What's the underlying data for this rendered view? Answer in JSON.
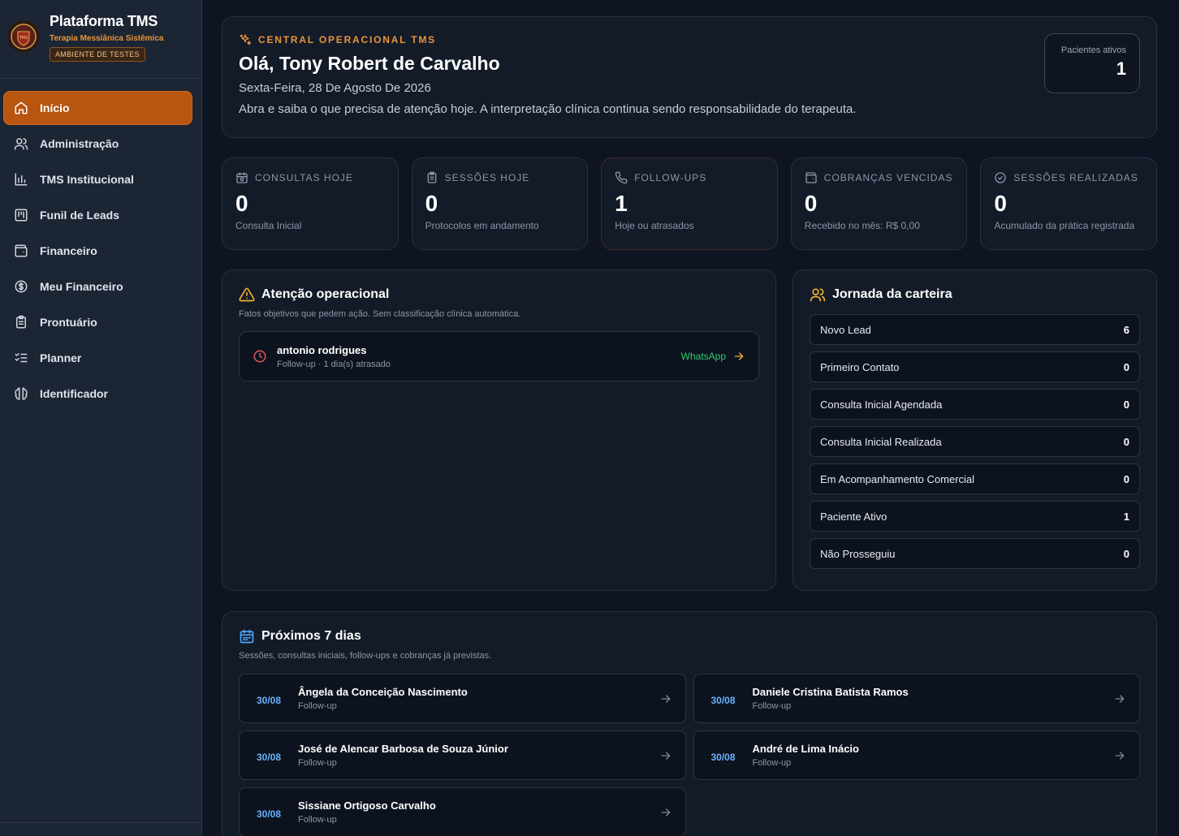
{
  "sidebar": {
    "brand_title": "Plataforma TMS",
    "brand_subtitle": "Terapia Messiânica Sistêmica",
    "env_badge": "AMBIENTE DE TESTES",
    "logo_text": "TMS",
    "items": [
      {
        "label": "Início",
        "icon": "home-icon",
        "active": true
      },
      {
        "label": "Administração",
        "icon": "users-icon"
      },
      {
        "label": "TMS Institucional",
        "icon": "bar-chart-icon"
      },
      {
        "label": "Funil de Leads",
        "icon": "kanban-icon"
      },
      {
        "label": "Financeiro",
        "icon": "wallet-icon"
      },
      {
        "label": "Meu Financeiro",
        "icon": "dollar-circle-icon"
      },
      {
        "label": "Prontuário",
        "icon": "clipboard-icon"
      },
      {
        "label": "Planner",
        "icon": "list-check-icon"
      },
      {
        "label": "Identificador",
        "icon": "brain-icon"
      }
    ]
  },
  "hero": {
    "eyebrow": "CENTRAL OPERACIONAL TMS",
    "greeting": "Olá, Tony Robert de Carvalho",
    "date": "Sexta-Feira, 28 De Agosto De 2026",
    "description": "Abra e saiba o que precisa de atenção hoje. A interpretação clínica continua sendo responsabilidade do terapeuta.",
    "active_patients_label": "Pacientes ativos",
    "active_patients_value": "1"
  },
  "stats": [
    {
      "label": "CONSULTAS HOJE",
      "value": "0",
      "sub": "Consulta Inicial",
      "icon": "calendar-clock-icon"
    },
    {
      "label": "SESSÕES HOJE",
      "value": "0",
      "sub": "Protocolos em andamento",
      "icon": "clipboard-list-icon"
    },
    {
      "label": "FOLLOW-UPS",
      "value": "1",
      "sub": "Hoje ou atrasados",
      "icon": "phone-icon"
    },
    {
      "label": "COBRANÇAS VENCIDAS",
      "value": "0",
      "sub": "Recebido no mês: R$ 0,00",
      "icon": "wallet-icon"
    },
    {
      "label": "SESSÕES REALIZADAS",
      "value": "0",
      "sub": "Acumulado da prática registrada",
      "icon": "check-circle-icon"
    }
  ],
  "attention": {
    "title": "Atenção operacional",
    "subtitle": "Fatos objetivos que pedem ação. Sem classificação clínica automática.",
    "items": [
      {
        "name": "antonio rodrigues",
        "meta": "Follow-up · 1 dia(s) atrasado",
        "action": "WhatsApp"
      }
    ]
  },
  "journey": {
    "title": "Jornada da carteira",
    "stages": [
      {
        "label": "Novo Lead",
        "count": "6"
      },
      {
        "label": "Primeiro Contato",
        "count": "0"
      },
      {
        "label": "Consulta Inicial Agendada",
        "count": "0"
      },
      {
        "label": "Consulta Inicial Realizada",
        "count": "0"
      },
      {
        "label": "Em Acompanhamento Comercial",
        "count": "0"
      },
      {
        "label": "Paciente Ativo",
        "count": "1"
      },
      {
        "label": "Não Prosseguiu",
        "count": "0"
      }
    ]
  },
  "next7": {
    "title": "Próximos 7 dias",
    "subtitle": "Sessões, consultas iniciais, follow-ups e cobranças já previstas.",
    "items": [
      {
        "date": "30/08",
        "name": "Ângela da Conceição Nascimento",
        "type": "Follow-up"
      },
      {
        "date": "30/08",
        "name": "Daniele Cristina Batista Ramos",
        "type": "Follow-up"
      },
      {
        "date": "30/08",
        "name": "José de Alencar Barbosa de Souza Júnior",
        "type": "Follow-up"
      },
      {
        "date": "30/08",
        "name": "André de Lima Inácio",
        "type": "Follow-up"
      },
      {
        "date": "30/08",
        "name": "Sissiane Ortigoso Carvalho",
        "type": "Follow-up"
      }
    ]
  },
  "colors": {
    "accent": "#b8550f",
    "brand_orange": "#e8953a",
    "date_blue": "#6ab2ff",
    "whatsapp_green": "#2fca74",
    "alert_red": "#e0575b"
  }
}
